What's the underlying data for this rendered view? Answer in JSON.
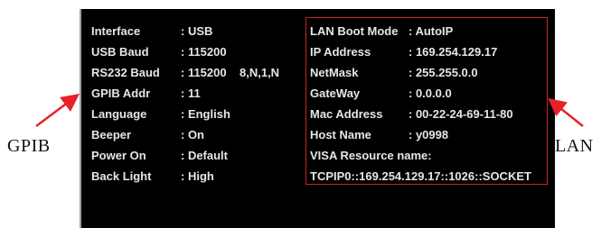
{
  "settings": {
    "left": [
      {
        "label": "Interface",
        "value": ": USB"
      },
      {
        "label": "USB Baud",
        "value": ": 115200"
      },
      {
        "label": "RS232 Baud",
        "value": ": 115200",
        "extra": "8,N,1,N"
      },
      {
        "label": "GPIB Addr",
        "value": ": 11"
      },
      {
        "label": "Language",
        "value": ": English"
      },
      {
        "label": "Beeper",
        "value": ": On"
      },
      {
        "label": "Power On",
        "value": ": Default"
      },
      {
        "label": "Back Light",
        "value": ": High"
      }
    ],
    "right": [
      {
        "label": "LAN Boot Mode",
        "value": ": AutoIP"
      },
      {
        "label": "IP Address",
        "value": ": 169.254.129.17"
      },
      {
        "label": "NetMask",
        "value": ": 255.255.0.0"
      },
      {
        "label": "GateWay",
        "value": ": 0.0.0.0"
      },
      {
        "label": "Mac Address",
        "value": ": 00-22-24-69-11-80"
      },
      {
        "label": "Host Name",
        "value": ": y0998"
      }
    ],
    "visa_label": "VISA Resource name:",
    "visa_value": "TCPIP0::169.254.129.17::1026::SOCKET"
  },
  "callouts": {
    "gpib": "GPIB",
    "lan": "LAN"
  },
  "colors": {
    "screen_background": "#000000",
    "text": "#e6e6e6",
    "highlight_box": "#c0282a",
    "arrow": "#e8202a"
  }
}
